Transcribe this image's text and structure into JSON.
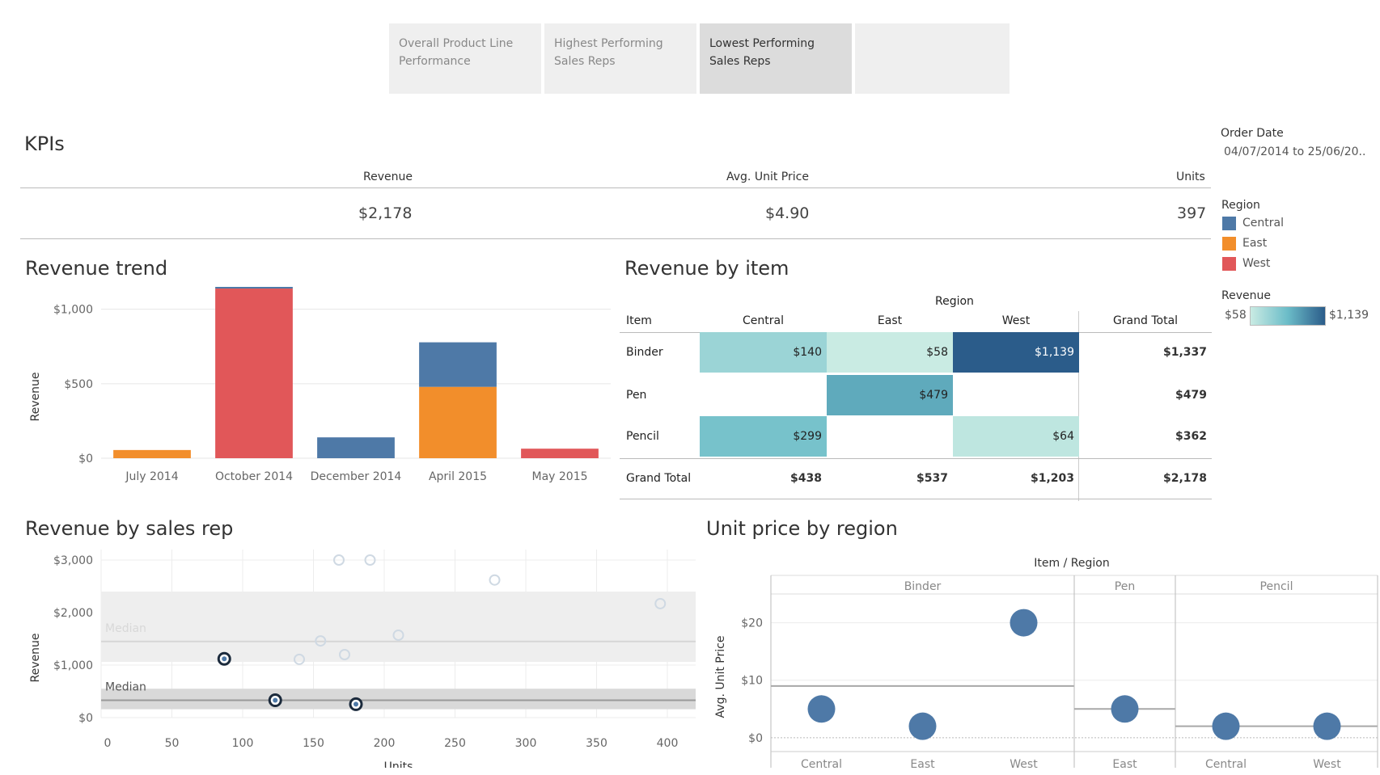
{
  "tabs": [
    {
      "label_1": "Overall Product Line",
      "label_2": "Performance"
    },
    {
      "label_1": "Highest Performing",
      "label_2": "Sales Reps"
    },
    {
      "label_1": "Lowest Performing",
      "label_2": "Sales Reps"
    },
    {
      "label_1": "",
      "label_2": ""
    }
  ],
  "kpis": {
    "title": "KPIs",
    "revenue_label": "Revenue",
    "revenue_value": "$2,178",
    "price_label": "Avg. Unit Price",
    "price_value": "$4.90",
    "units_label": "Units",
    "units_value": "397"
  },
  "filters": {
    "order_date_label": "Order Date",
    "order_date_value": "04/07/2014 to 25/06/20..",
    "region_label": "Region",
    "regions": [
      "Central",
      "East",
      "West"
    ],
    "revenue_label": "Revenue",
    "revenue_min": "$58",
    "revenue_max": "$1,139"
  },
  "colors": {
    "central": "#4e79a7",
    "east": "#f28e2b",
    "west": "#e15759"
  },
  "revenue_trend": {
    "title": "Revenue trend",
    "chart_data": {
      "type": "bar",
      "stacked": true,
      "ylabel": "Revenue",
      "ylim": [
        0,
        1150
      ],
      "yticks": [
        "$0",
        "$500",
        "$1,000"
      ],
      "yticks_values": [
        0,
        500,
        1000
      ],
      "categories": [
        "July 2014",
        "October 2014",
        "December 2014",
        "April 2015",
        "May 2015"
      ],
      "series": [
        {
          "name": "East",
          "values": [
            55,
            0,
            0,
            479,
            0
          ]
        },
        {
          "name": "West",
          "values": [
            0,
            1139,
            0,
            0,
            64
          ]
        },
        {
          "name": "Central",
          "values": [
            0,
            20,
            140,
            299,
            0
          ]
        }
      ]
    }
  },
  "revenue_by_item": {
    "title": "Revenue by item",
    "region_header": "Region",
    "item_header": "Item",
    "columns": [
      "Central",
      "East",
      "West",
      "Grand Total"
    ],
    "rows": [
      {
        "item": "Binder",
        "values": [
          "$140",
          "$58",
          "$1,139"
        ],
        "total": "$1,337",
        "shade": [
          140,
          58,
          1139
        ]
      },
      {
        "item": "Pen",
        "values": [
          "",
          "$479",
          ""
        ],
        "total": "$479",
        "shade": [
          null,
          479,
          null
        ]
      },
      {
        "item": "Pencil",
        "values": [
          "$299",
          "",
          "$64"
        ],
        "total": "$362",
        "shade": [
          299,
          null,
          64
        ]
      }
    ],
    "grand_total_label": "Grand Total",
    "grand_totals": [
      "$438",
      "$537",
      "$1,203",
      "$2,178"
    ]
  },
  "revenue_by_rep": {
    "title": "Revenue by sales rep",
    "chart_data": {
      "type": "scatter",
      "xlabel": "Units",
      "ylabel": "Revenue",
      "xlim": [
        0,
        420
      ],
      "ylim": [
        0,
        3200
      ],
      "xticks": [
        0,
        50,
        100,
        150,
        200,
        250,
        300,
        350,
        400
      ],
      "yticks": [
        "$0",
        "$1,000",
        "$2,000",
        "$3,000"
      ],
      "yticks_values": [
        0,
        1000,
        2000,
        3000
      ],
      "median_label": "Median",
      "highlighted": [
        {
          "x": 87,
          "y": 1120
        },
        {
          "x": 123,
          "y": 330
        },
        {
          "x": 180,
          "y": 255
        }
      ],
      "faded": [
        {
          "x": 168,
          "y": 3000
        },
        {
          "x": 190,
          "y": 3000
        },
        {
          "x": 278,
          "y": 2620
        },
        {
          "x": 395,
          "y": 2170
        },
        {
          "x": 210,
          "y": 1570
        },
        {
          "x": 155,
          "y": 1460
        },
        {
          "x": 172,
          "y": 1200
        },
        {
          "x": 140,
          "y": 1110
        }
      ],
      "band_light": [
        1060,
        2400
      ],
      "median_light": 1450,
      "band_dark": [
        160,
        550
      ],
      "median_dark": 330
    }
  },
  "unit_price": {
    "title": "Unit price by region",
    "header": "Item  /  Region",
    "ylabel": "Avg. Unit Price",
    "chart_data": {
      "type": "scatter",
      "ylim": [
        -1,
        25
      ],
      "yticks": [
        "$0",
        "$10",
        "$20"
      ],
      "yticks_values": [
        0,
        10,
        20
      ],
      "panes": [
        {
          "item": "Binder",
          "regions": [
            "Central",
            "East",
            "West"
          ],
          "values": [
            5,
            2,
            20
          ],
          "avg": 9
        },
        {
          "item": "Pen",
          "regions": [
            "East"
          ],
          "values": [
            5
          ],
          "avg": 5
        },
        {
          "item": "Pencil",
          "regions": [
            "Central",
            "West"
          ],
          "values": [
            2,
            2
          ],
          "avg": 2
        }
      ]
    }
  }
}
